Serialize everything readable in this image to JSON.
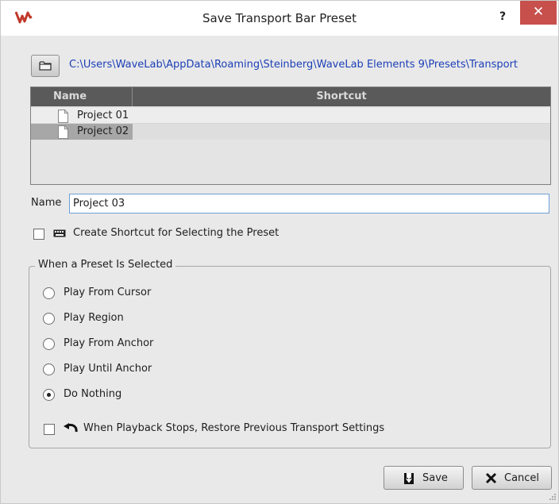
{
  "window": {
    "title": "Save Transport Bar Preset",
    "help_label": "?",
    "close_label": "✕",
    "app_icon": "wavelab-logo-icon"
  },
  "path": {
    "folder_icon": "folder-icon",
    "text": "C:\\Users\\WaveLab\\AppData\\Roaming\\Steinberg\\WaveLab Elements 9\\Presets\\Transport"
  },
  "presets_list": {
    "columns": [
      "Name",
      "Shortcut"
    ],
    "rows": [
      {
        "name": "Project 01",
        "shortcut": ""
      },
      {
        "name": "Project 02",
        "shortcut": "",
        "selected": true
      }
    ]
  },
  "name_field": {
    "label": "Name",
    "value": "Project 03"
  },
  "shortcut_option": {
    "label": "Create Shortcut for Selecting the Preset",
    "checked": false,
    "icon": "keyboard-icon"
  },
  "when_selected": {
    "title": "When a Preset Is Selected",
    "options": [
      {
        "label": "Play From Cursor",
        "checked": false
      },
      {
        "label": "Play Region",
        "checked": false
      },
      {
        "label": "Play From Anchor",
        "checked": false
      },
      {
        "label": "Play Until Anchor",
        "checked": false
      },
      {
        "label": "Do Nothing",
        "checked": true
      }
    ],
    "restore": {
      "label": "When Playback Stops, Restore Previous Transport Settings",
      "checked": false,
      "icon": "undo-icon"
    }
  },
  "buttons": {
    "save_label": "Save",
    "cancel_label": "Cancel"
  },
  "colors": {
    "close_button": "#c7504c",
    "path_link": "#1c3fb7",
    "list_header": "#5a5a5a",
    "selected_row": "#a7a7a7"
  }
}
